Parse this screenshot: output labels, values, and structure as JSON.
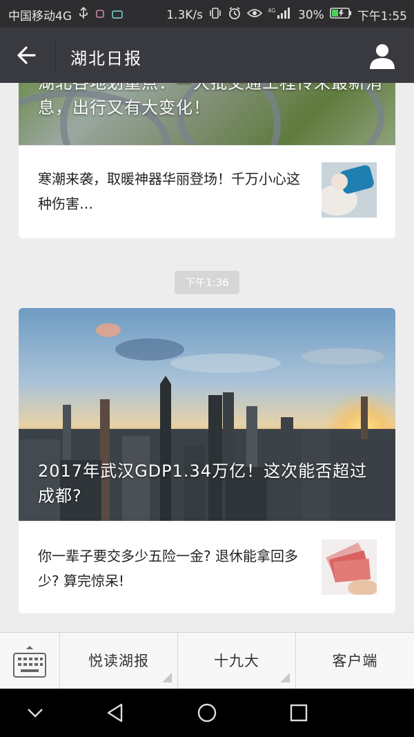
{
  "status_bar": {
    "carrier": "中国移动4G",
    "speed": "1.3K/s",
    "battery": "30%",
    "time": "下午1:55"
  },
  "header": {
    "title": "湖北日报"
  },
  "feed": {
    "card1": {
      "hero_title": "湖北各地划重点：一大批交通工程传来最新消息，出行又有大变化！",
      "sub_title": "寒潮来袭，取暖神器华丽登场！千万小心这种伤害…"
    },
    "timestamp": "下午1:36",
    "card2": {
      "hero_title": "2017年武汉GDP1.34万亿！这次能否超过成都?",
      "sub_title": "你一辈子要交多少五险一金? 退休能拿回多少? 算完惊呆!"
    }
  },
  "bottom_menu": {
    "items": [
      {
        "label": "悦读湖报"
      },
      {
        "label": "十九大"
      },
      {
        "label": "客户端"
      }
    ]
  },
  "colors": {
    "nav_bg": "#393a3f",
    "status_bg": "#2d2d2f",
    "page_bg": "#ededed"
  }
}
